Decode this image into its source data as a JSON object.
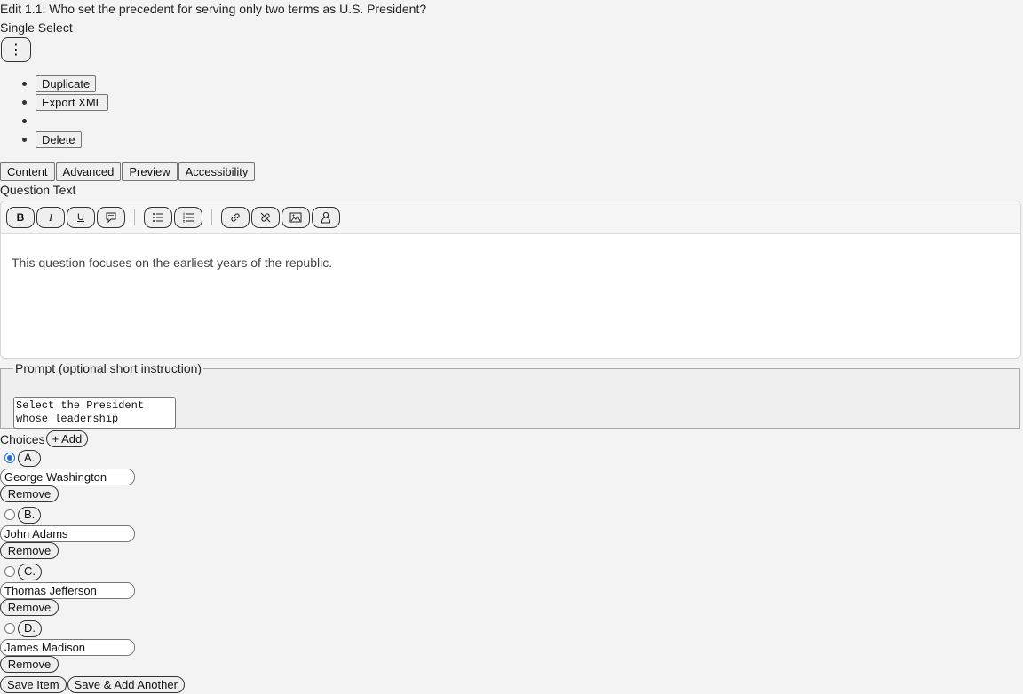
{
  "header": {
    "title": "Edit 1.1: Who set the precedent for serving only two terms as U.S. President?",
    "subtitle": "Single Select"
  },
  "kebab": {
    "glyph": "⋮",
    "icon": "kebab-icon"
  },
  "menu": {
    "duplicate": "Duplicate",
    "export_xml": "Export XML",
    "delete": "Delete"
  },
  "tabs": [
    "Content",
    "Advanced",
    "Preview",
    "Accessibility"
  ],
  "question_text": {
    "label": "Question Text",
    "body": "This question focuses on the earliest years of the republic.",
    "toolbar": {
      "bold": "B",
      "italic": "I",
      "underline": "U",
      "icons": [
        "comment-icon",
        "bulleted-list-icon",
        "numbered-list-icon",
        "link-icon",
        "unlink-icon",
        "image-icon",
        "person-icon"
      ]
    }
  },
  "prompt": {
    "legend": "Prompt (optional short instruction)",
    "value": "Select the President whose leadership"
  },
  "choices": {
    "label": "Choices",
    "add_label": "+ Add",
    "remove_label": "Remove",
    "items": [
      {
        "letter": "A.",
        "value": "George Washington",
        "checked": true
      },
      {
        "letter": "B.",
        "value": "John Adams",
        "checked": false
      },
      {
        "letter": "C.",
        "value": "Thomas Jefferson",
        "checked": false
      },
      {
        "letter": "D.",
        "value": "James Madison",
        "checked": false
      }
    ]
  },
  "footer": {
    "save": "Save Item",
    "save_add": "Save & Add Another"
  },
  "colors": {
    "radio_checked": "#1a6ed8",
    "page_bg": "#f3f3f3"
  }
}
